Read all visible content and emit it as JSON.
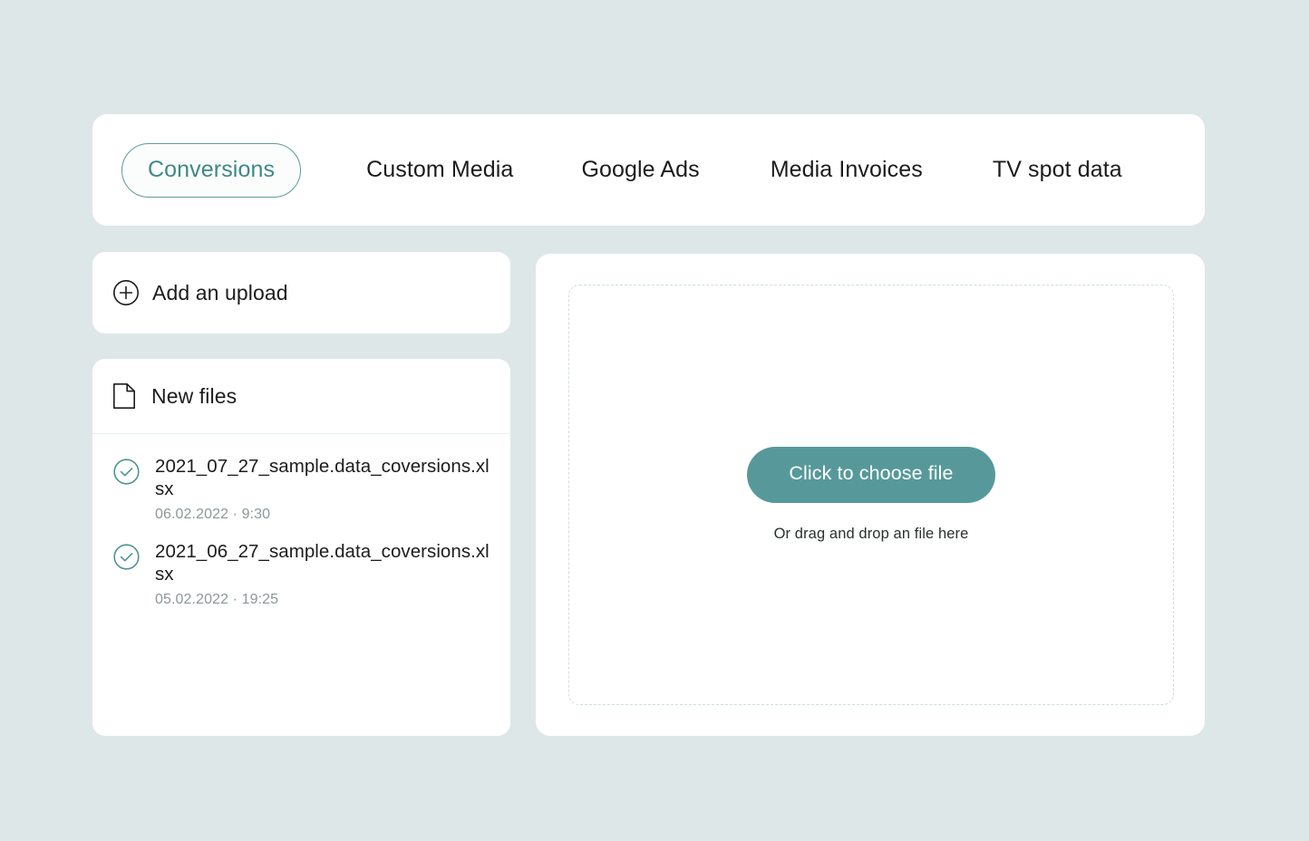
{
  "theme": {
    "page_background": "#dde7e8",
    "card_background": "#ffffff",
    "accent": "#57999a",
    "accent_border": "#5e9c9a",
    "muted_text": "#8d9799",
    "dashed_border": "#cfdddd"
  },
  "tabs": [
    {
      "label": "Conversions",
      "active": true,
      "name": "tab-conversions"
    },
    {
      "label": "Custom Media",
      "active": false,
      "name": "tab-custom-media"
    },
    {
      "label": "Google Ads",
      "active": false,
      "name": "tab-google-ads"
    },
    {
      "label": "Media Invoices",
      "active": false,
      "name": "tab-media-invoices"
    },
    {
      "label": "TV spot data",
      "active": false,
      "name": "tab-tv-spot-data"
    }
  ],
  "add_upload": {
    "label": "Add an upload",
    "icon": "plus-circle-icon"
  },
  "new_files": {
    "header_label": "New files",
    "header_icon": "document-icon",
    "items": [
      {
        "name": "2021_07_27_sample.data_coversions.xlsx",
        "meta": "06.02.2022 · 9:30",
        "status_icon": "check-circle-icon"
      },
      {
        "name": "2021_06_27_sample.data_coversions.xlsx",
        "meta": "05.02.2022 · 19:25",
        "status_icon": "check-circle-icon"
      }
    ]
  },
  "dropzone": {
    "button_label": "Click to choose file",
    "hint": "Or drag and drop an file here"
  }
}
